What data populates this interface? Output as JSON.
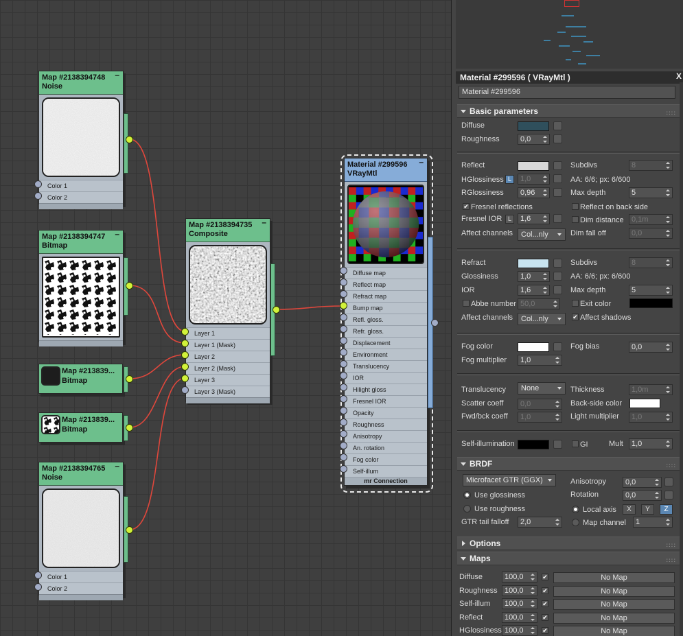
{
  "colors": {
    "node_green": "#6dbf8c",
    "node_blue": "#86acd8",
    "wire": "#e0473c",
    "socket_on": "#d2f23a",
    "accent": "#5b87b3"
  },
  "nodes": {
    "noise1": {
      "title": "Map #2138394748",
      "type": "Noise",
      "slots": [
        "Color 1",
        "Color 2"
      ]
    },
    "bitmap1": {
      "title": "Map #2138394747",
      "type": "Bitmap"
    },
    "bitmap2": {
      "title": "Map #213839...",
      "type": "Bitmap"
    },
    "bitmap3": {
      "title": "Map #213839...",
      "type": "Bitmap"
    },
    "noise2": {
      "title": "Map #2138394765",
      "type": "Noise",
      "slots": [
        "Color 1",
        "Color 2"
      ]
    },
    "composite": {
      "title": "Map #2138394735",
      "type": "Composite",
      "slots": [
        "Layer 1",
        "Layer 1 (Mask)",
        "Layer 2",
        "Layer 2 (Mask)",
        "Layer 3",
        "Layer 3 (Mask)"
      ]
    },
    "vray": {
      "title": "Material #299596",
      "type": "VRayMtl",
      "slots": [
        "Diffuse map",
        "Reflect map",
        "Refract map",
        "Bump map",
        "Refl. gloss.",
        "Refr. gloss.",
        "Displacement",
        "Environment",
        "Translucency",
        "IOR",
        "Hilight gloss",
        "Fresnel IOR",
        "Opacity",
        "Roughness",
        "Anisotropy",
        "An. rotation",
        "Fog color",
        "Self-illum"
      ],
      "footer": "mr Connection"
    }
  },
  "panel": {
    "title": "Material #299596  ( VRayMtl )",
    "close": "X",
    "name_field": "Material #299596",
    "basic_header": "Basic parameters",
    "diffuse": {
      "label": "Diffuse",
      "color": "#2f4f5c"
    },
    "roughness": {
      "label": "Roughness",
      "value": "0,0"
    },
    "reflect": {
      "label": "Reflect",
      "color": "#d8d8d8",
      "subdivs_label": "Subdivs",
      "subdivs": "8",
      "hgloss_label": "HGlossiness",
      "hgloss": "1,0",
      "L": "L",
      "aa": "AA: 6/6; px: 6/600",
      "rgloss_label": "RGlossiness",
      "rgloss": "0,96",
      "maxdepth_label": "Max depth",
      "maxdepth": "5",
      "fresnel_label": "Fresnel reflections",
      "backside_label": "Reflect on back side",
      "fior_label": "Fresnel IOR",
      "fior": "1,6",
      "dimdist_label": "Dim distance",
      "dimdist": "0,1m",
      "affect_label": "Affect channels",
      "affect": "Col...nly",
      "dimfall_label": "Dim fall off",
      "dimfall": "0,0"
    },
    "refract": {
      "label": "Refract",
      "color": "#c8e4f0",
      "subdivs_label": "Subdivs",
      "subdivs": "8",
      "gloss_label": "Glossiness",
      "gloss": "1,0",
      "aa": "AA: 6/6; px: 6/600",
      "ior_label": "IOR",
      "ior": "1,6",
      "maxdepth_label": "Max depth",
      "maxdepth": "5",
      "abbe_label": "Abbe number",
      "abbe": "50,0",
      "exit_label": "Exit color",
      "exit_color": "#000000",
      "affect_label": "Affect channels",
      "affect": "Col...nly",
      "shadows_label": "Affect shadows"
    },
    "fog": {
      "color_label": "Fog color",
      "color": "#ffffff",
      "bias_label": "Fog bias",
      "bias": "0,0",
      "mult_label": "Fog multiplier",
      "mult": "1,0"
    },
    "trans": {
      "label": "Translucency",
      "value": "None",
      "thick_label": "Thickness",
      "thick": "1,0m",
      "scatter_label": "Scatter coeff",
      "scatter": "0,0",
      "back_label": "Back-side color",
      "back_color": "#ffffff",
      "fwd_label": "Fwd/bck coeff",
      "fwd": "1,0",
      "light_label": "Light multiplier",
      "light": "1,0"
    },
    "selfillum": {
      "label": "Self-illumination",
      "color": "#000000",
      "gi_label": "GI",
      "mult_label": "Mult",
      "mult": "1,0"
    },
    "brdf": {
      "header": "BRDF",
      "type": "Microfacet GTR (GGX)",
      "aniso_label": "Anisotropy",
      "aniso": "0,0",
      "rot_label": "Rotation",
      "rot": "0,0",
      "useg_label": "Use glossiness",
      "user_label": "Use roughness",
      "local_label": "Local axis",
      "x": "X",
      "y": "Y",
      "z": "Z",
      "gtr_label": "GTR tail falloff",
      "gtr": "2,0",
      "mapch_label": "Map channel",
      "mapch": "1"
    },
    "options_header": "Options",
    "maps_header": "Maps",
    "maps": [
      {
        "name": "Diffuse",
        "amount": "100,0",
        "slot": "No Map"
      },
      {
        "name": "Roughness",
        "amount": "100,0",
        "slot": "No Map"
      },
      {
        "name": "Self-illum",
        "amount": "100,0",
        "slot": "No Map"
      },
      {
        "name": "Reflect",
        "amount": "100,0",
        "slot": "No Map"
      },
      {
        "name": "HGlossiness",
        "amount": "100,0",
        "slot": "No Map"
      }
    ]
  }
}
